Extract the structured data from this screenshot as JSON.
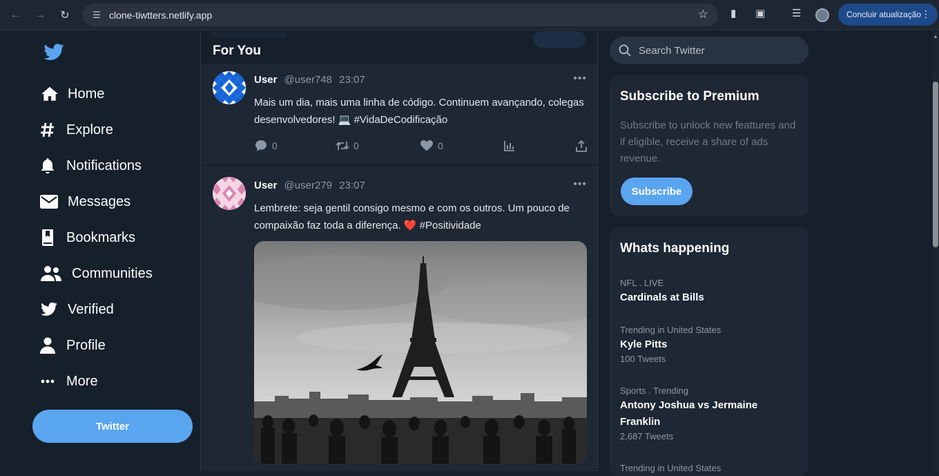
{
  "browser": {
    "url": "clone-tiwtters.netlify.app",
    "update_label": "Concluir atualização"
  },
  "sidebar": {
    "items": [
      {
        "label": "Home",
        "icon": "home-icon"
      },
      {
        "label": "Explore",
        "icon": "hashtag-icon"
      },
      {
        "label": "Notifications",
        "icon": "bell-icon"
      },
      {
        "label": "Messages",
        "icon": "envelope-icon"
      },
      {
        "label": "Bookmarks",
        "icon": "bookmark-icon"
      },
      {
        "label": "Communities",
        "icon": "users-icon"
      },
      {
        "label": "Verified",
        "icon": "twitter-bird-icon"
      },
      {
        "label": "Profile",
        "icon": "user-icon"
      },
      {
        "label": "More",
        "icon": "more-dots-icon"
      }
    ],
    "tweet_button": "Twitter"
  },
  "feed": {
    "title": "For You",
    "tweets": [
      {
        "name": "User",
        "handle": "@user748",
        "time": "23:07",
        "text": "Mais um dia, mais uma linha de código. Continuem avançando, colegas desenvolvedores! 💻 #VidaDeCodificação",
        "replies": "0",
        "retweets": "0",
        "likes": "0"
      },
      {
        "name": "User",
        "handle": "@user279",
        "time": "23:07",
        "text": "Lembrete: seja gentil consigo mesmo e com os outros. Um pouco de compaixão faz toda a diferença. ❤️ #Positividade"
      }
    ]
  },
  "right": {
    "search_placeholder": "Search Twitter",
    "premium": {
      "title": "Subscribe to Premium",
      "description": "Subscribe to unlock new feattures and if eligible, receive a share of ads revenue.",
      "button": "Subscribe"
    },
    "happening": {
      "title": "Whats happening",
      "trends": [
        {
          "category": "NFL . LIVE",
          "title": "Cardinals at Bills",
          "count": ""
        },
        {
          "category": "Trending in United States",
          "title": "Kyle Pitts",
          "count": "100 Tweets"
        },
        {
          "category": "Sports . Trending",
          "title": "Antony Joshua vs Jermaine Franklin",
          "count": "2,687 Tweets"
        },
        {
          "category": "Trending in United States",
          "title": "",
          "count": ""
        }
      ]
    }
  },
  "colors": {
    "background": "#15202b",
    "card": "#1e2734",
    "accent": "#5aa5ef"
  }
}
